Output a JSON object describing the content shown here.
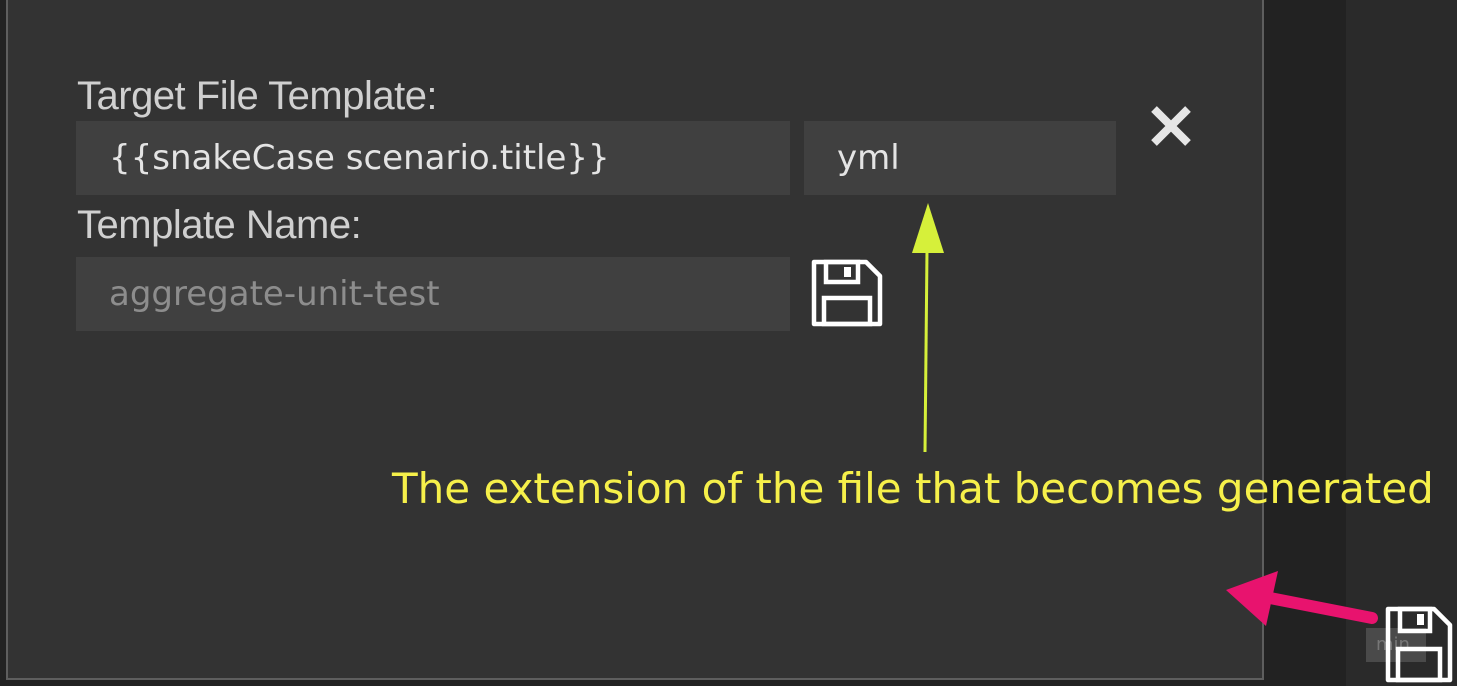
{
  "form": {
    "target_template_label": "Target File Template:",
    "target_template_value": "{{snakeCase scenario.title}}",
    "extension_value": "yml",
    "template_name_label": "Template Name:",
    "template_name_placeholder": "aggregate-unit-test"
  },
  "icons": {
    "close": "close-icon",
    "save": "floppy-disk-icon",
    "save_external": "floppy-disk-icon"
  },
  "annotation": {
    "text": "The extension of the file that becomes generated",
    "text_color": "#f6f04a",
    "arrow_color_green": "#d6f03a",
    "arrow_color_pink": "#e8136e"
  },
  "mini_label": "min"
}
